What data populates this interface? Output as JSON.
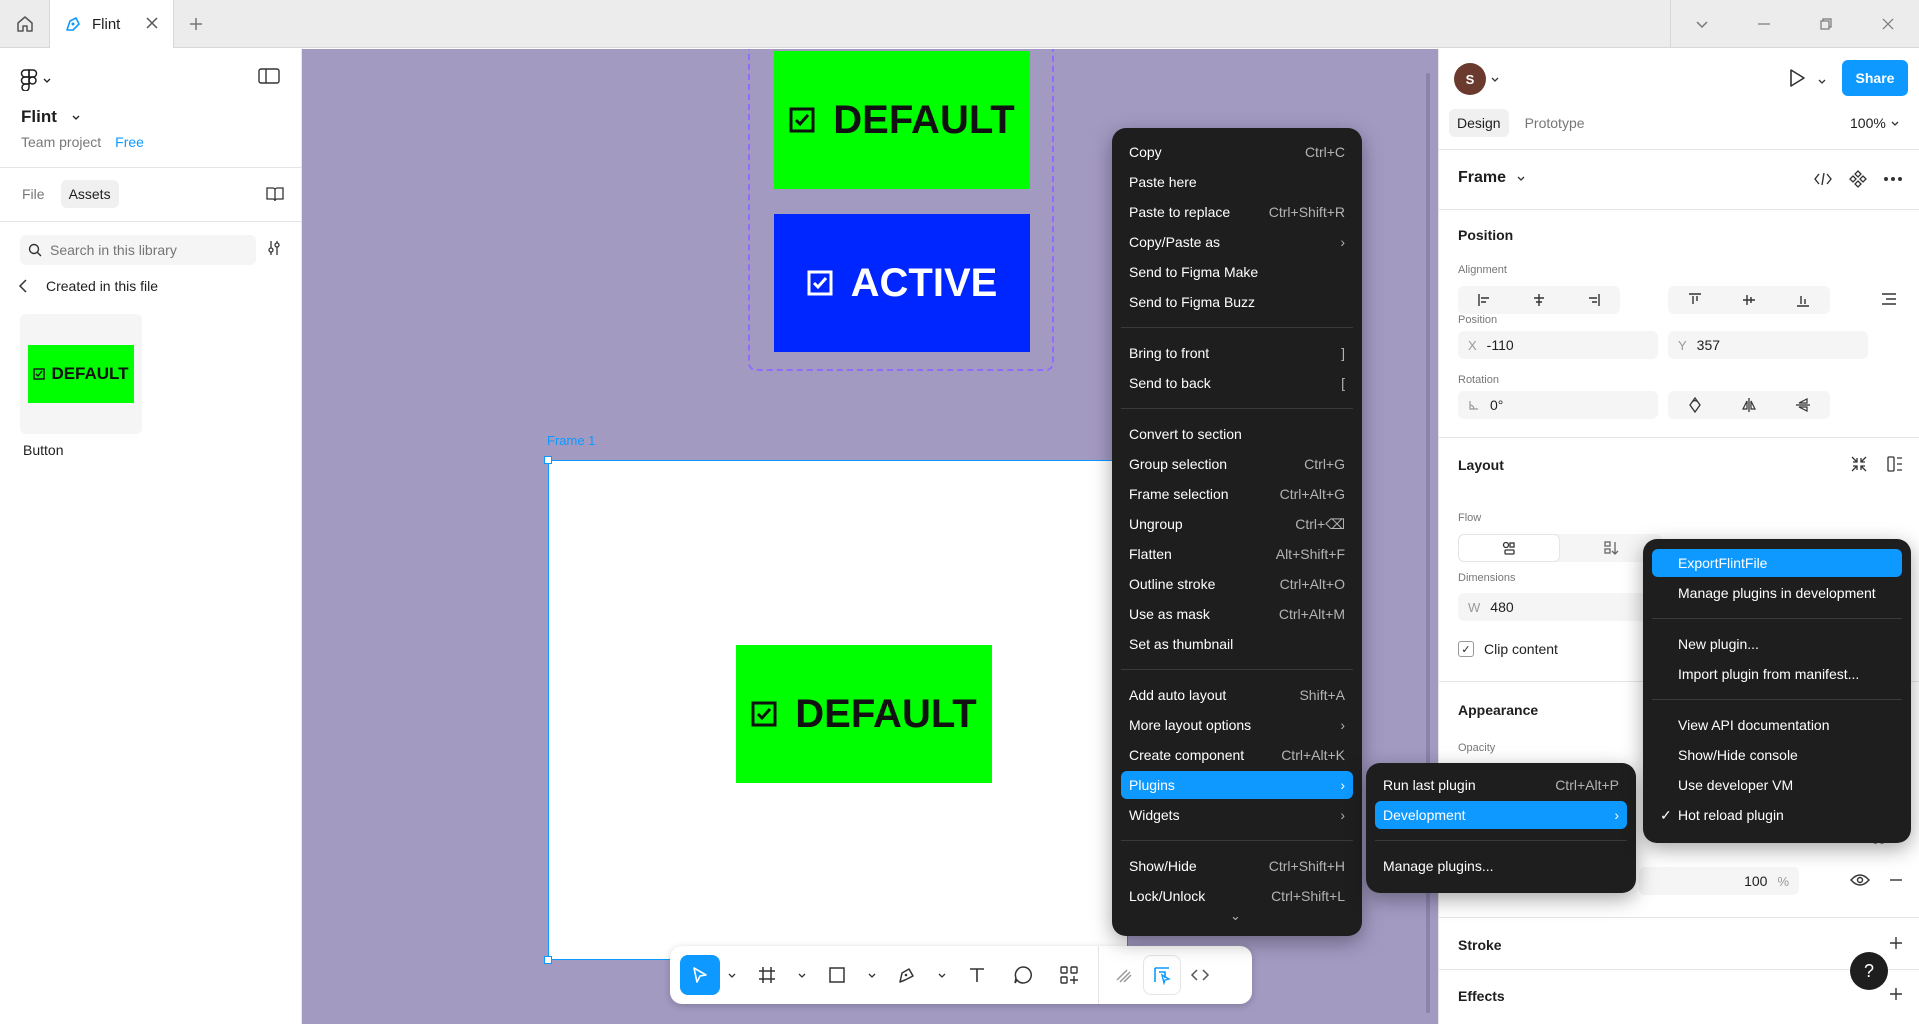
{
  "titlebar": {
    "tab_label": "Flint"
  },
  "left": {
    "file_name": "Flint",
    "team": "Team project",
    "plan": "Free",
    "tab_file": "File",
    "tab_assets": "Assets",
    "search_placeholder": "Search in this library",
    "back_label": "Created in this file",
    "asset_thumb_text": "DEFAULT",
    "asset_label": "Button"
  },
  "canvas": {
    "btn_default_text": "DEFAULT",
    "btn_active_text": "ACTIVE",
    "frame_label": "Frame 1",
    "frame_button_text": "DEFAULT",
    "colors": {
      "canvas": "#a39ac2",
      "green": "#00ff00",
      "blue": "#0026ff",
      "selection": "#0d99ff"
    }
  },
  "right": {
    "avatar": "S",
    "share": "Share",
    "tab_design": "Design",
    "tab_prototype": "Prototype",
    "zoom": "100%",
    "frame_title": "Frame",
    "position_heading": "Position",
    "alignment_label": "Alignment",
    "position_label": "Position",
    "x_key": "X",
    "x_val": "-110",
    "y_key": "Y",
    "y_val": "357",
    "rotation_label": "Rotation",
    "rotation_val": "0°",
    "layout_heading": "Layout",
    "flow_label": "Flow",
    "dimensions_label": "Dimensions",
    "w_key": "W",
    "w_val": "480",
    "clip_content": "Clip content",
    "appearance_heading": "Appearance",
    "opacity_label": "Opacity",
    "opacity_partial": "00",
    "fill_opacity": "100",
    "percent": "%",
    "stroke_heading": "Stroke",
    "effects_heading": "Effects",
    "help": "?"
  },
  "context_menu": {
    "items": [
      {
        "label": "Copy",
        "shortcut": "Ctrl+C"
      },
      {
        "label": "Paste here",
        "shortcut": ""
      },
      {
        "label": "Paste to replace",
        "shortcut": "Ctrl+Shift+R"
      },
      {
        "label": "Copy/Paste as",
        "shortcut": "›"
      },
      {
        "label": "Send to Figma Make",
        "shortcut": ""
      },
      {
        "label": "Send to Figma Buzz",
        "shortcut": ""
      },
      {
        "label": "Bring to front",
        "shortcut": "]"
      },
      {
        "label": "Send to back",
        "shortcut": "["
      },
      {
        "label": "Convert to section",
        "shortcut": ""
      },
      {
        "label": "Group selection",
        "shortcut": "Ctrl+G"
      },
      {
        "label": "Frame selection",
        "shortcut": "Ctrl+Alt+G"
      },
      {
        "label": "Ungroup",
        "shortcut": "Ctrl+⌫"
      },
      {
        "label": "Flatten",
        "shortcut": "Alt+Shift+F"
      },
      {
        "label": "Outline stroke",
        "shortcut": "Ctrl+Alt+O"
      },
      {
        "label": "Use as mask",
        "shortcut": "Ctrl+Alt+M"
      },
      {
        "label": "Set as thumbnail",
        "shortcut": ""
      },
      {
        "label": "Add auto layout",
        "shortcut": "Shift+A"
      },
      {
        "label": "More layout options",
        "shortcut": "›"
      },
      {
        "label": "Create component",
        "shortcut": "Ctrl+Alt+K"
      },
      {
        "label": "Plugins",
        "shortcut": "›"
      },
      {
        "label": "Widgets",
        "shortcut": "›"
      },
      {
        "label": "Show/Hide",
        "shortcut": "Ctrl+Shift+H"
      },
      {
        "label": "Lock/Unlock",
        "shortcut": "Ctrl+Shift+L"
      }
    ],
    "more_indicator": "⌄"
  },
  "plugins_menu": {
    "items": [
      {
        "label": "Run last plugin",
        "shortcut": "Ctrl+Alt+P"
      },
      {
        "label": "Development",
        "shortcut": "›"
      },
      {
        "label": "Manage plugins...",
        "shortcut": ""
      }
    ]
  },
  "dev_menu": {
    "items": [
      {
        "label": "ExportFlintFile",
        "check": ""
      },
      {
        "label": "Manage plugins in development",
        "check": ""
      },
      {
        "label": "New plugin...",
        "check": ""
      },
      {
        "label": "Import plugin from manifest...",
        "check": ""
      },
      {
        "label": "View API documentation",
        "check": ""
      },
      {
        "label": "Show/Hide console",
        "check": ""
      },
      {
        "label": "Use developer VM",
        "check": ""
      },
      {
        "label": "Hot reload plugin",
        "check": "✓"
      }
    ]
  }
}
